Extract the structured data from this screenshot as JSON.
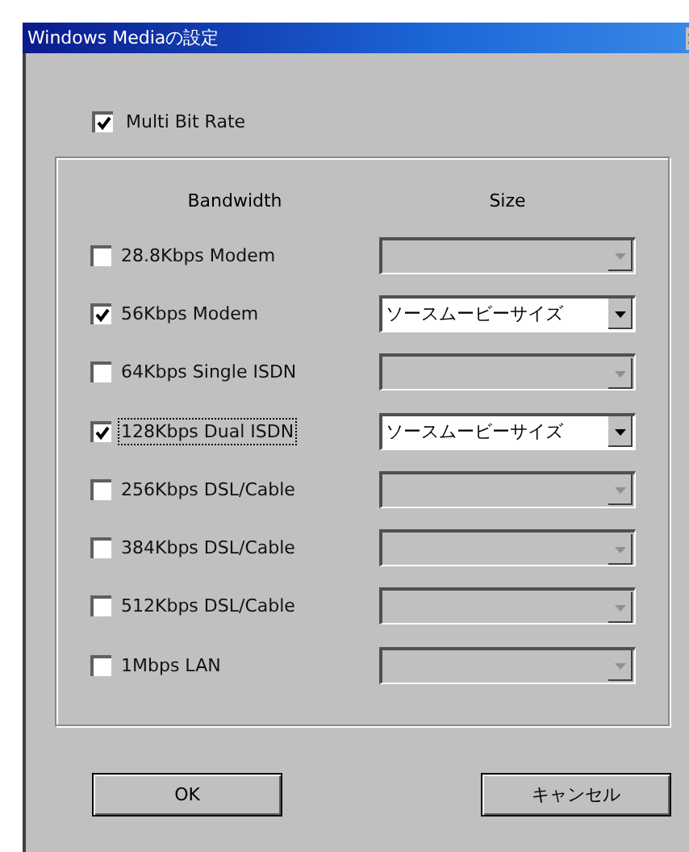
{
  "window": {
    "title": "Windows Mediaの設定"
  },
  "multi_bit_rate": {
    "label": "Multi Bit Rate",
    "checked": true
  },
  "columns": [
    "Bandwidth",
    "Size"
  ],
  "rows": [
    {
      "label": "28.8Kbps Modem",
      "checked": false,
      "focused": false,
      "size": {
        "disabled": true
      }
    },
    {
      "label": "56Kbps Modem",
      "checked": true,
      "focused": false,
      "size": {
        "disabled": false,
        "value": "ソースムービーサイズ"
      }
    },
    {
      "label": "64Kbps Single ISDN",
      "checked": false,
      "focused": false,
      "size": {
        "disabled": true
      }
    },
    {
      "label": "128Kbps Dual ISDN",
      "checked": true,
      "focused": true,
      "size": {
        "disabled": false,
        "value": "ソースムービーサイズ"
      }
    },
    {
      "label": "256Kbps DSL/Cable",
      "checked": false,
      "focused": false,
      "size": {
        "disabled": true
      }
    },
    {
      "label": "384Kbps DSL/Cable",
      "checked": false,
      "focused": false,
      "size": {
        "disabled": true
      }
    },
    {
      "label": "512Kbps DSL/Cable",
      "checked": false,
      "focused": false,
      "size": {
        "disabled": true
      }
    },
    {
      "label": "1Mbps LAN",
      "checked": false,
      "focused": false,
      "size": {
        "disabled": true
      }
    }
  ],
  "buttons": [
    "OK",
    "キャンセル"
  ]
}
